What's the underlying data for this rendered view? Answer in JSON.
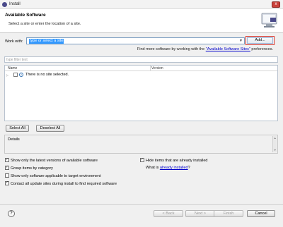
{
  "window": {
    "title": "Install",
    "close_glyph": "x"
  },
  "header": {
    "title": "Available Software",
    "description": "Select a site or enter the location of a site."
  },
  "work_with": {
    "label": "Work with:",
    "value": "type or select a site",
    "add_label": "Add..."
  },
  "find_more": {
    "prefix": "Find more software by working with the ",
    "link": "\"Available Software Sites\"",
    "suffix": " preferences."
  },
  "filter": {
    "placeholder": "type filter text"
  },
  "table": {
    "columns": [
      "Name",
      "Version"
    ],
    "rows": [
      {
        "text": "There is no site selected."
      }
    ]
  },
  "buttons": {
    "select_all": "Select All",
    "deselect_all": "Deselect All"
  },
  "details": {
    "label": "Details"
  },
  "options": {
    "latest_versions": {
      "label": "Show only the latest versions of available software",
      "checked": true
    },
    "group_by_category": {
      "label": "Group items by category",
      "checked": true
    },
    "target_env": {
      "label": "Show only software applicable to target environment",
      "checked": false
    },
    "contact_sites": {
      "label": "Contact all update sites during install to find required software",
      "checked": true
    },
    "hide_installed": {
      "label": "Hide items that are already installed",
      "checked": true
    },
    "what_is_prefix": "What is ",
    "what_is_link": "already installed",
    "what_is_suffix": "?"
  },
  "footer": {
    "help": "?",
    "back": "< Back",
    "next": "Next >",
    "finish": "Finish",
    "cancel": "Cancel"
  },
  "colors": {
    "accent": "#3399ff",
    "link": "#0000cc",
    "highlight_border": "#d9372b"
  }
}
